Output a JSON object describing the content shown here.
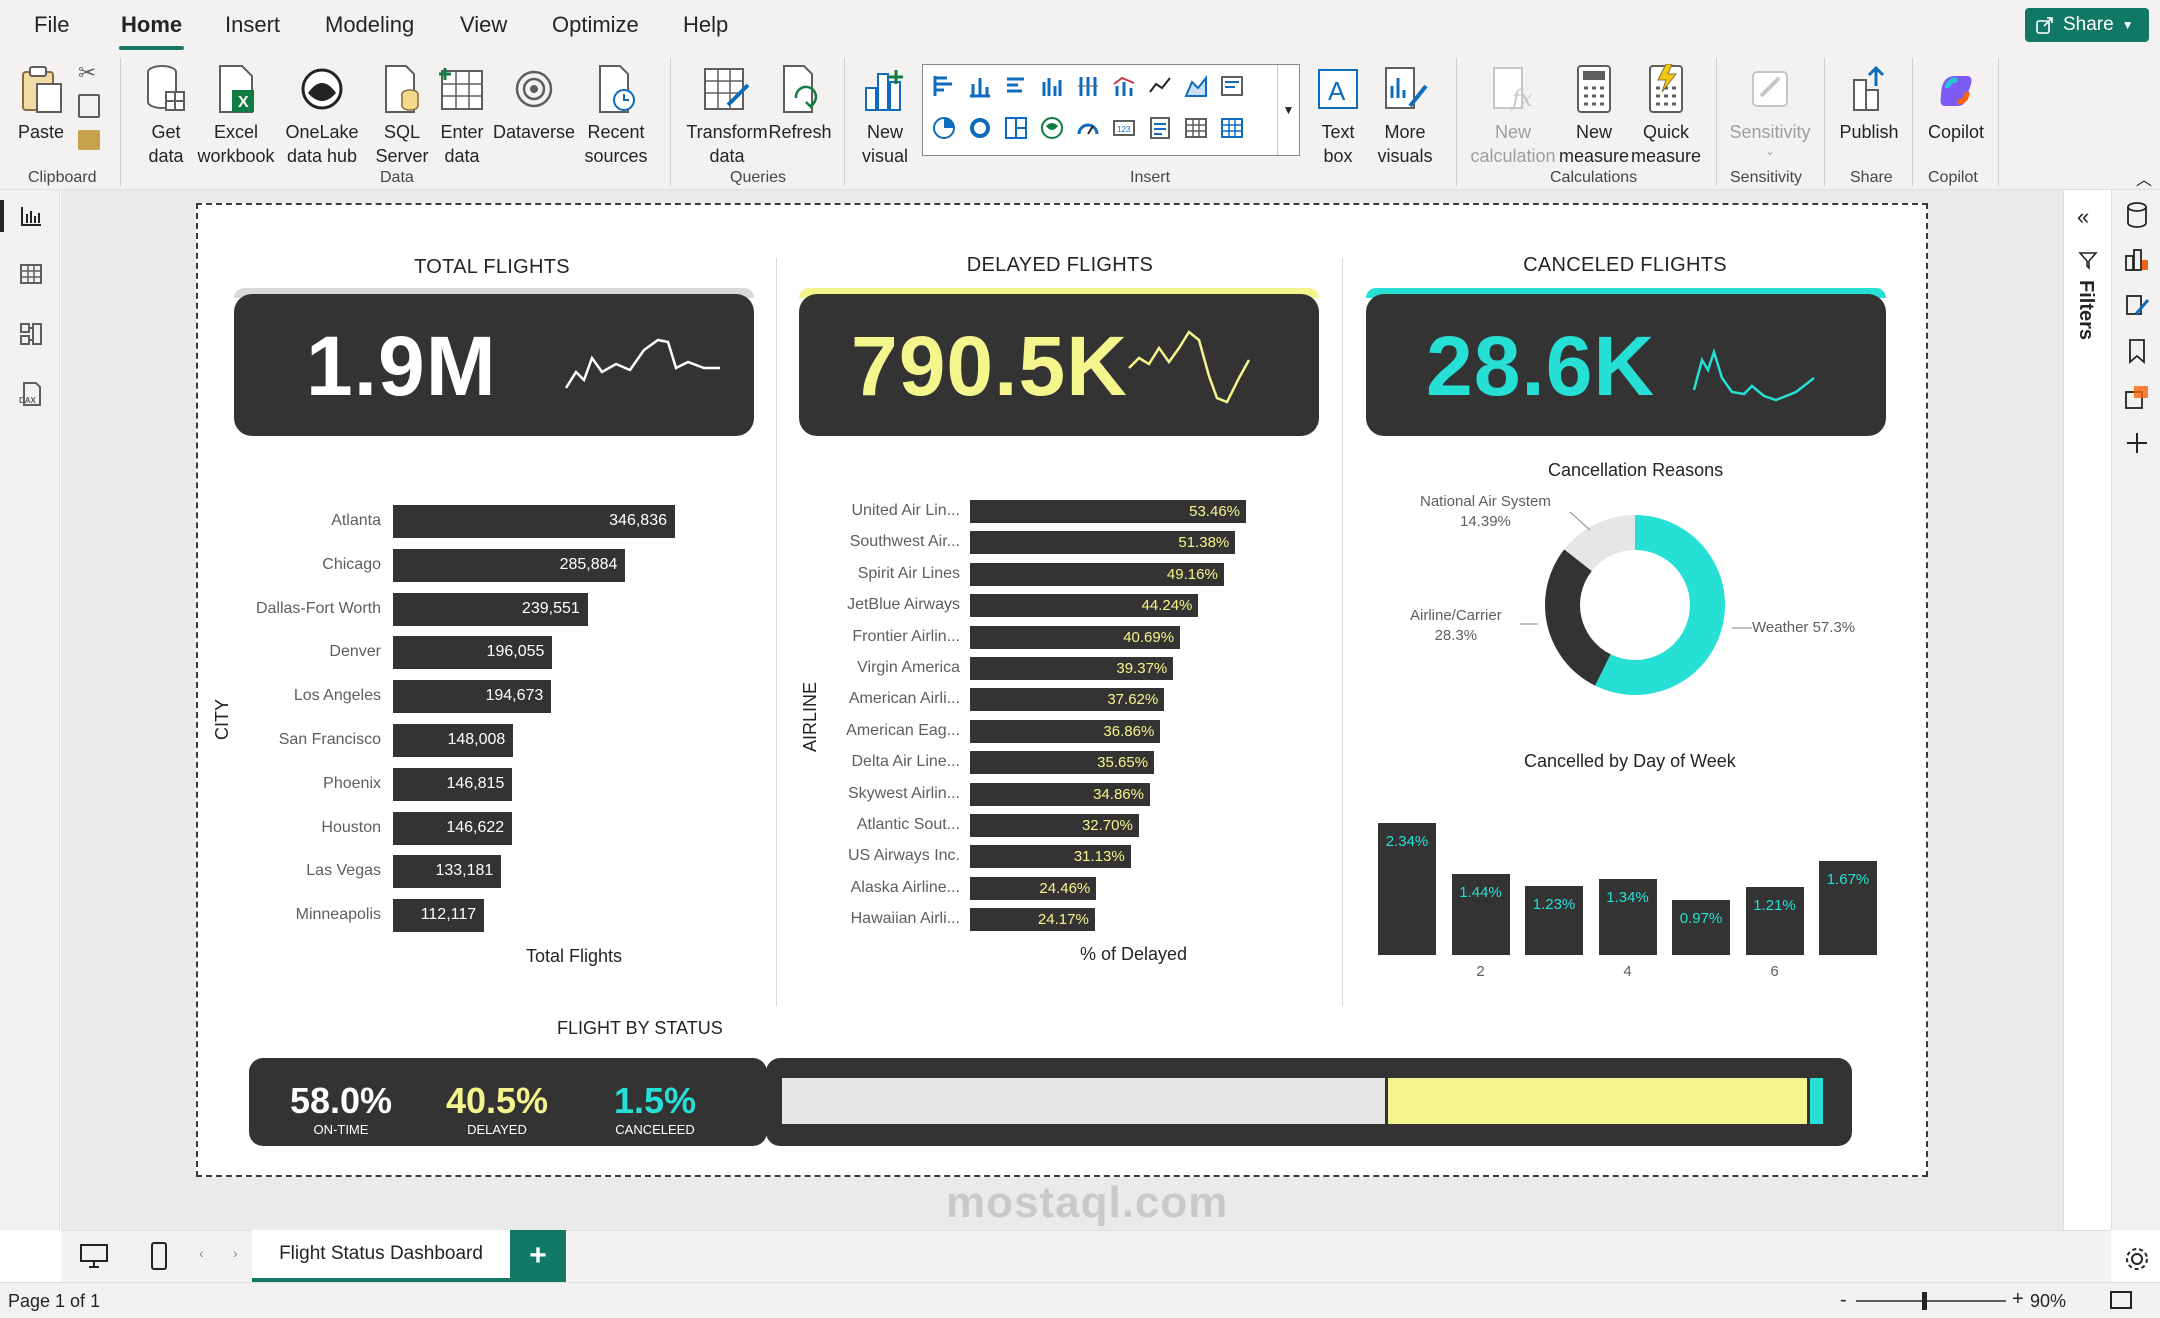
{
  "menu": {
    "items": [
      "File",
      "Home",
      "Insert",
      "Modeling",
      "View",
      "Optimize",
      "Help"
    ],
    "share_label": "Share"
  },
  "ribbon": {
    "paste": "Paste",
    "get_data": "Get data",
    "excel": "Excel workbook",
    "onelake": "OneLake data hub",
    "sql": "SQL Server",
    "enter_data": "Enter data",
    "dataverse": "Dataverse",
    "recent": "Recent sources",
    "transform": "Transform data",
    "refresh": "Refresh",
    "new_visual": "New visual",
    "text_box": "Text box",
    "more_visuals": "More visuals",
    "new_calc": "New calculation",
    "new_measure": "New measure",
    "quick_measure": "Quick measure",
    "sensitivity": "Sensitivity",
    "publish": "Publish",
    "copilot": "Copilot",
    "groups": {
      "clipboard": "Clipboard",
      "data": "Data",
      "queries": "Queries",
      "insert": "Insert",
      "calculations": "Calculations",
      "sensitivity": "Sensitivity",
      "share": "Share",
      "copilot": "Copilot"
    }
  },
  "filters_label": "Filters",
  "report": {
    "kpis": [
      {
        "title": "TOTAL FLIGHTS",
        "value": "1.9M",
        "color": "#ffffff",
        "accent": "#d9d9d9"
      },
      {
        "title": "DELAYED FLIGHTS",
        "value": "790.5K",
        "color": "#f5f58e",
        "accent": "#f5f58e"
      },
      {
        "title": "CANCELED FLIGHTS",
        "value": "28.6K",
        "color": "#26e0d6",
        "accent": "#26e0d6"
      }
    ],
    "city_chart": {
      "axis_y": "CITY",
      "axis_x": "Total Flights",
      "cities": [
        "Atlanta",
        "Chicago",
        "Dallas-Fort Worth",
        "Denver",
        "Los Angeles",
        "San Francisco",
        "Phoenix",
        "Houston",
        "Las Vegas",
        "Minneapolis"
      ],
      "values": [
        346836,
        285884,
        239551,
        196055,
        194673,
        148008,
        146815,
        146622,
        133181,
        112117
      ],
      "labels": [
        "346,836",
        "285,884",
        "239,551",
        "196,055",
        "194,673",
        "148,008",
        "146,815",
        "146,622",
        "133,181",
        "112,117"
      ]
    },
    "airline_chart": {
      "axis_y": "AIRLINE",
      "axis_x": "% of Delayed",
      "airlines": [
        "United Air Lin...",
        "Southwest Air...",
        "Spirit Air Lines",
        "JetBlue Airways",
        "Frontier Airlin...",
        "Virgin America",
        "American Airli...",
        "American Eag...",
        "Delta Air Line...",
        "Skywest Airlin...",
        "Atlantic Sout...",
        "US Airways Inc.",
        "Alaska Airline...",
        "Hawaiian Airli..."
      ],
      "values": [
        53.46,
        51.38,
        49.16,
        44.24,
        40.69,
        39.37,
        37.62,
        36.86,
        35.65,
        34.86,
        32.7,
        31.13,
        24.46,
        24.17
      ],
      "labels": [
        "53.46%",
        "51.38%",
        "49.16%",
        "44.24%",
        "40.69%",
        "39.37%",
        "37.62%",
        "36.86%",
        "35.65%",
        "34.86%",
        "32.70%",
        "31.13%",
        "24.46%",
        "24.17%"
      ]
    },
    "cancel_reasons": {
      "title": "Cancellation Reasons",
      "slices": [
        {
          "name": "Weather",
          "value": 57.3,
          "label": "Weather 57.3%",
          "color": "#26e0d6"
        },
        {
          "name": "Airline/Carrier",
          "value": 28.3,
          "label_name": "Airline/Carrier",
          "label_pct": "28.3%",
          "color": "#333333"
        },
        {
          "name": "National Air System",
          "value": 14.39,
          "label_name": "National Air System",
          "label_pct": "14.39%",
          "color": "#e6e6e6"
        }
      ]
    },
    "cancel_dow": {
      "title": "Cancelled by Day of Week",
      "days": [
        1,
        2,
        3,
        4,
        5,
        6,
        7
      ],
      "values": [
        2.34,
        1.44,
        1.23,
        1.34,
        0.97,
        1.21,
        1.67
      ],
      "labels": [
        "2.34%",
        "1.44%",
        "1.23%",
        "1.34%",
        "0.97%",
        "1.21%",
        "1.67%"
      ],
      "ticks": [
        "2",
        "4",
        "6"
      ]
    },
    "status": {
      "title": "FLIGHT BY STATUS",
      "items": [
        {
          "value": "58.0%",
          "caption": "ON-TIME",
          "color": "#ffffff",
          "fill": 58.0,
          "bar_color": "#e6e6e6"
        },
        {
          "value": "40.5%",
          "caption": "DELAYED",
          "color": "#f5f58e",
          "fill": 40.5,
          "bar_color": "#f5f58e"
        },
        {
          "value": "1.5%",
          "caption": "CANCELEED",
          "color": "#26e0d6",
          "fill": 1.5,
          "bar_color": "#26e0d6"
        }
      ]
    }
  },
  "tabs": {
    "page": "Flight Status Dashboard",
    "add": "+"
  },
  "status_bar": {
    "page": "Page 1 of 1",
    "zoom": "90%"
  },
  "watermark": "mostaql.com",
  "colors": {
    "brand": "#117865",
    "dark": "#333333",
    "yellow": "#f5f58e",
    "teal": "#26e0d6"
  },
  "chart_data": [
    {
      "type": "bar",
      "title": "",
      "xlabel": "Total Flights",
      "ylabel": "CITY",
      "categories": [
        "Atlanta",
        "Chicago",
        "Dallas-Fort Worth",
        "Denver",
        "Los Angeles",
        "San Francisco",
        "Phoenix",
        "Houston",
        "Las Vegas",
        "Minneapolis"
      ],
      "values": [
        346836,
        285884,
        239551,
        196055,
        194673,
        148008,
        146815,
        146622,
        133181,
        112117
      ]
    },
    {
      "type": "bar",
      "title": "",
      "xlabel": "% of Delayed",
      "ylabel": "AIRLINE",
      "categories": [
        "United Air Lin...",
        "Southwest Air...",
        "Spirit Air Lines",
        "JetBlue Airways",
        "Frontier Airlin...",
        "Virgin America",
        "American Airli...",
        "American Eag...",
        "Delta Air Line...",
        "Skywest Airlin...",
        "Atlantic Sout...",
        "US Airways Inc.",
        "Alaska Airline...",
        "Hawaiian Airli..."
      ],
      "values": [
        53.46,
        51.38,
        49.16,
        44.24,
        40.69,
        39.37,
        37.62,
        36.86,
        35.65,
        34.86,
        32.7,
        31.13,
        24.46,
        24.17
      ]
    },
    {
      "type": "pie",
      "title": "Cancellation Reasons",
      "categories": [
        "Weather",
        "Airline/Carrier",
        "National Air System"
      ],
      "values": [
        57.3,
        28.3,
        14.39
      ]
    },
    {
      "type": "bar",
      "title": "Cancelled by Day of Week",
      "categories": [
        1,
        2,
        3,
        4,
        5,
        6,
        7
      ],
      "values": [
        2.34,
        1.44,
        1.23,
        1.34,
        0.97,
        1.21,
        1.67
      ]
    }
  ]
}
